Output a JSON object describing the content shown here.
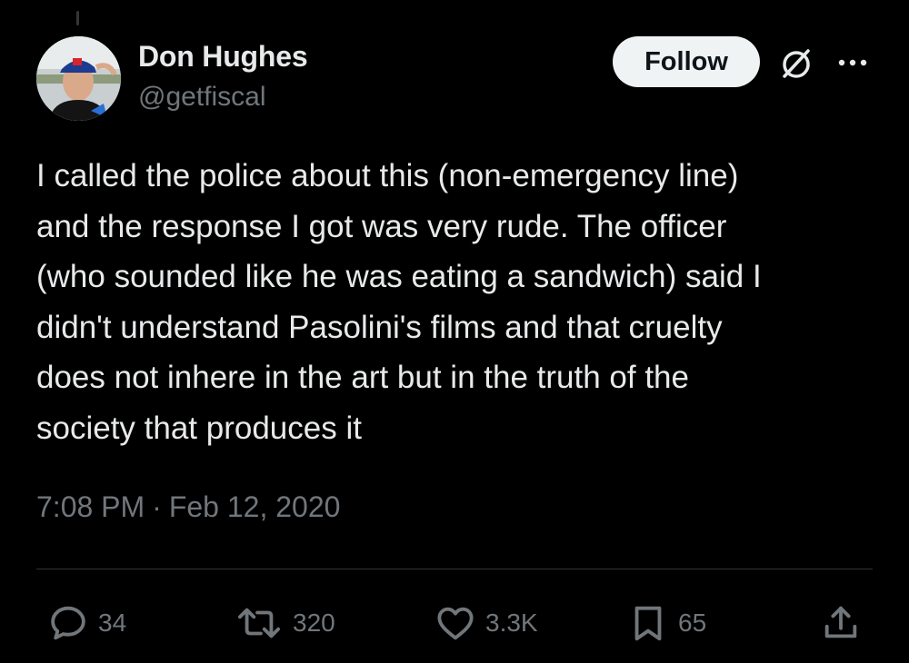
{
  "author": {
    "display_name": "Don Hughes",
    "handle": "@getfiscal",
    "avatar_icon": "profile-photo"
  },
  "header": {
    "follow_label": "Follow",
    "grok_icon": "grok-icon",
    "more_icon": "more-horizontal-icon"
  },
  "tweet": {
    "text": "I called the police about this (non-emergency line)\nand the response I got was very rude. The officer\n(who sounded like he was eating a sandwich) said I\ndidn't understand Pasolini's films and that cruelty\ndoes not inhere in the art but in the truth of the\nsociety that produces it",
    "time": "7:08 PM",
    "separator": "·",
    "date": "Feb 12, 2020"
  },
  "actions": {
    "replies": "34",
    "reposts": "320",
    "likes": "3.3K",
    "bookmarks": "65"
  },
  "colors": {
    "background": "#000000",
    "primary_text": "#e7e9ea",
    "secondary_text": "#71767b",
    "follow_bg": "#eff3f4",
    "divider": "#2f3336"
  }
}
